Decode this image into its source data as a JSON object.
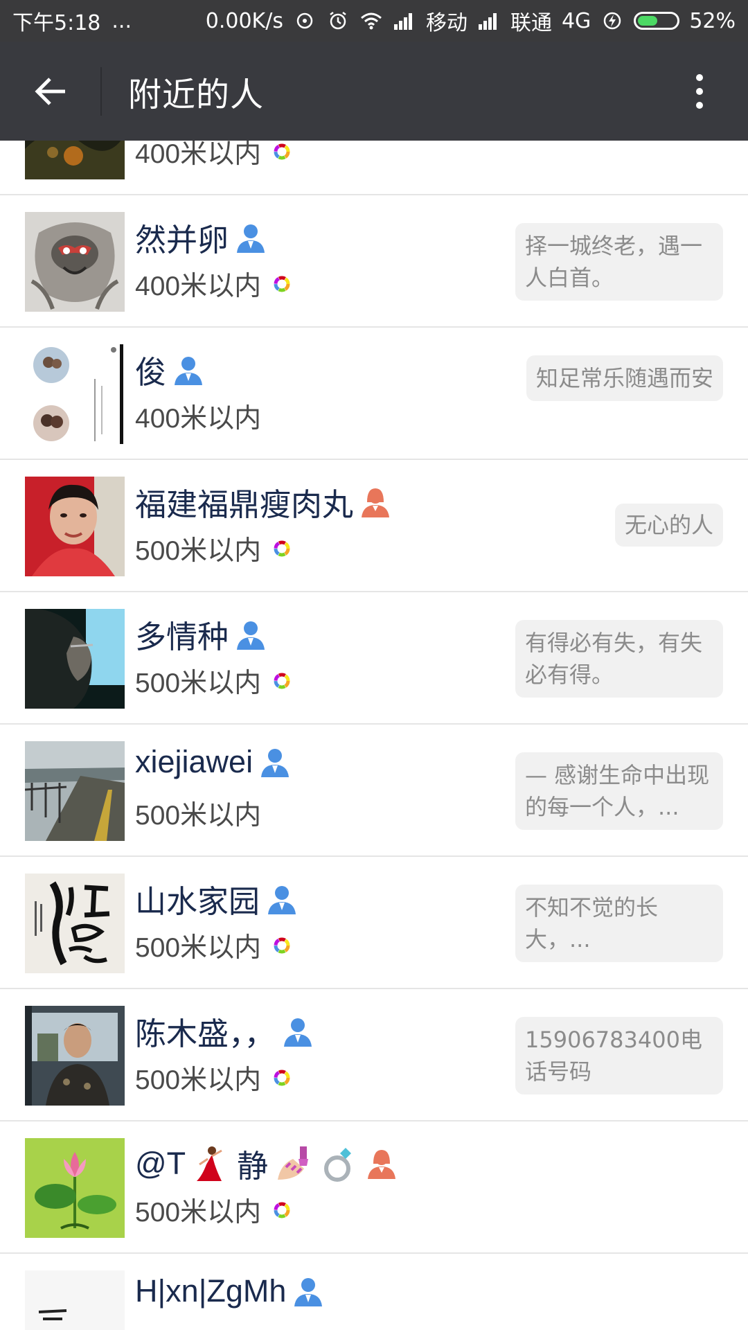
{
  "status_bar": {
    "time": "下午5:18",
    "more": "...",
    "speed": "0.00K/s",
    "carrier1": "移动",
    "carrier2": "联通",
    "network": "4G",
    "battery": "52%",
    "battery_level": 0.52,
    "battery_color": "#4cd964"
  },
  "toolbar": {
    "title": "附近的人",
    "back_icon": "arrow-left-icon",
    "more_icon": "more-vertical-icon"
  },
  "colors": {
    "toolbar_bg": "#393a3f",
    "male_icon": "#4a90e2",
    "female_icon": "#e8765a",
    "name_text": "#1a2a4d"
  },
  "people": [
    {
      "name": "",
      "distance": "400米以内",
      "gender": "",
      "signature": "",
      "has_wheel": true
    },
    {
      "name": "然并卵",
      "distance": "400米以内",
      "gender": "male",
      "signature": "择一城终老，遇一人白首。",
      "has_wheel": true
    },
    {
      "name": "俊",
      "distance": "400米以内",
      "gender": "male",
      "signature": "知足常乐随遇而安",
      "has_wheel": false
    },
    {
      "name": "福建福鼎瘦肉丸",
      "distance": "500米以内",
      "gender": "female",
      "signature": "无心的人",
      "has_wheel": true
    },
    {
      "name": "多情种",
      "distance": "500米以内",
      "gender": "male",
      "signature": "有得必有失，有失必有得。",
      "has_wheel": true
    },
    {
      "name": "xiejiawei",
      "distance": "500米以内",
      "gender": "male",
      "signature": "— 感谢生命中出现的每一个人，...",
      "has_wheel": false
    },
    {
      "name": "山水家园",
      "distance": "500米以内",
      "gender": "male",
      "signature": "不知不觉的长大，...",
      "has_wheel": true
    },
    {
      "name": "陈木盛，，",
      "distance": "500米以内",
      "gender": "male",
      "signature": "15906783400电话号码",
      "has_wheel": true
    },
    {
      "name_parts": [
        "@T",
        "静"
      ],
      "name": "@T静",
      "distance": "500米以内",
      "gender": "female",
      "signature": "",
      "has_wheel": true
    },
    {
      "name": "H|xn|ZgMh",
      "distance": "",
      "gender": "male",
      "signature": "",
      "has_wheel": false
    }
  ]
}
